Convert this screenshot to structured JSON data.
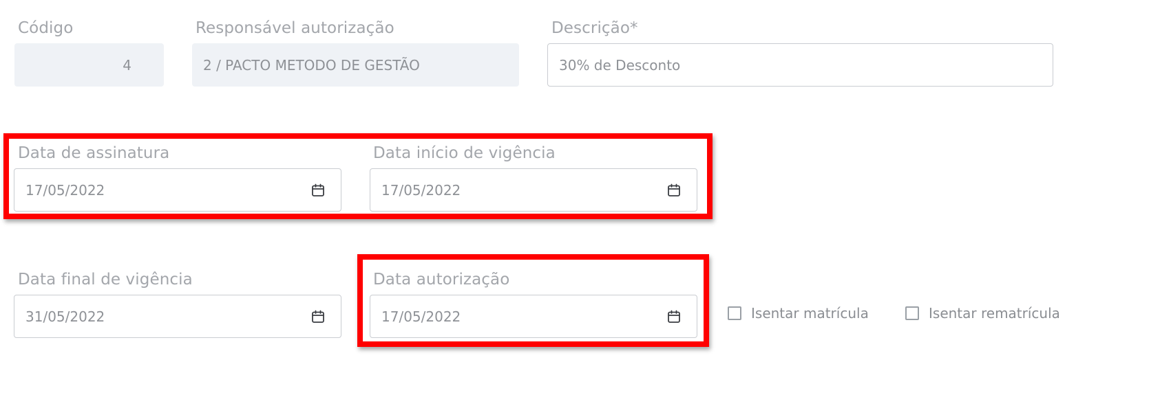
{
  "form": {
    "codigo": {
      "label": "Código",
      "value": "4"
    },
    "responsavel": {
      "label": "Responsável autorização",
      "value": "2 / PACTO METODO DE GESTÃO"
    },
    "descricao": {
      "label": "Descrição*",
      "value": "30% de Desconto"
    },
    "data_assinatura": {
      "label": "Data de assinatura",
      "value": "17/05/2022"
    },
    "data_inicio_vigencia": {
      "label": "Data início de vigência",
      "value": "17/05/2022"
    },
    "data_final_vigencia": {
      "label": "Data final de vigência",
      "value": "31/05/2022"
    },
    "data_autorizacao": {
      "label": "Data autorização",
      "value": "17/05/2022"
    },
    "isentar_matricula": {
      "label": "Isentar matrícula",
      "checked": false
    },
    "isentar_rematricula": {
      "label": "Isentar rematrícula",
      "checked": false
    }
  },
  "icons": {
    "date_picker": "calendar-icon"
  },
  "colors": {
    "highlight": "#ff0000",
    "readonly_bg": "#eff2f6",
    "border": "#c9ccd1",
    "label": "#a3a6ab"
  }
}
